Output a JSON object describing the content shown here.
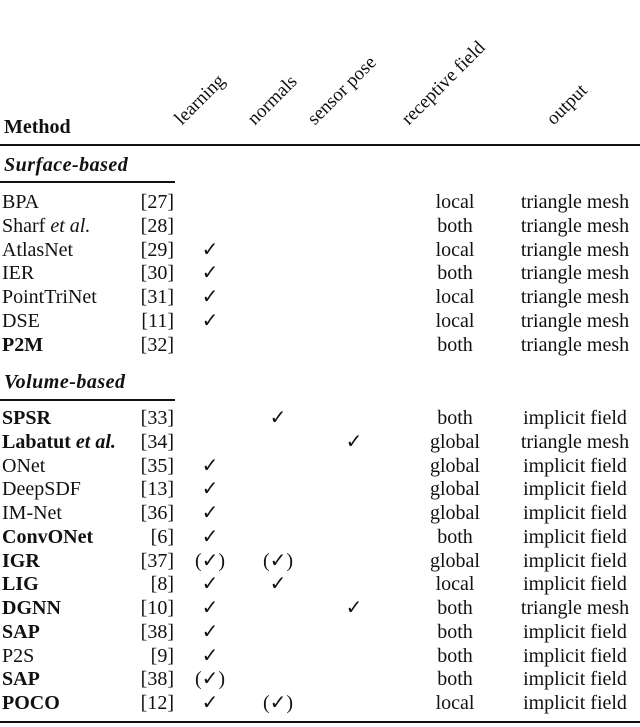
{
  "table": {
    "method_header": "Method",
    "column_headers": [
      "learning",
      "normals",
      "sensor pose",
      "receptive field",
      "output"
    ],
    "sections": [
      {
        "title": "Surface-based",
        "rows": [
          {
            "method": "BPA",
            "method_suffix": "",
            "bold": false,
            "ref": "[27]",
            "learning": "",
            "normals": "",
            "sensor_pose": "",
            "receptive_field": "local",
            "output": "triangle mesh"
          },
          {
            "method": "Sharf ",
            "method_suffix": "et al.",
            "bold": false,
            "ref": "[28]",
            "learning": "",
            "normals": "",
            "sensor_pose": "",
            "receptive_field": "both",
            "output": "triangle mesh"
          },
          {
            "method": "AtlasNet",
            "method_suffix": "",
            "bold": false,
            "ref": "[29]",
            "learning": "✓",
            "normals": "",
            "sensor_pose": "",
            "receptive_field": "local",
            "output": "triangle mesh"
          },
          {
            "method": "IER",
            "method_suffix": "",
            "bold": false,
            "ref": "[30]",
            "learning": "✓",
            "normals": "",
            "sensor_pose": "",
            "receptive_field": "both",
            "output": "triangle mesh"
          },
          {
            "method": "PointTriNet",
            "method_suffix": "",
            "bold": false,
            "ref": "[31]",
            "learning": "✓",
            "normals": "",
            "sensor_pose": "",
            "receptive_field": "local",
            "output": "triangle mesh"
          },
          {
            "method": "DSE",
            "method_suffix": "",
            "bold": false,
            "ref": "[11]",
            "learning": "✓",
            "normals": "",
            "sensor_pose": "",
            "receptive_field": "local",
            "output": "triangle mesh"
          },
          {
            "method": "P2M",
            "method_suffix": "",
            "bold": true,
            "ref": "[32]",
            "learning": "",
            "normals": "",
            "sensor_pose": "",
            "receptive_field": "both",
            "output": "triangle mesh"
          }
        ]
      },
      {
        "title": "Volume-based",
        "rows": [
          {
            "method": "SPSR",
            "method_suffix": "",
            "bold": true,
            "ref": "[33]",
            "learning": "",
            "normals": "✓",
            "sensor_pose": "",
            "receptive_field": "both",
            "output": "implicit field"
          },
          {
            "method": "Labatut ",
            "method_suffix": "et al.",
            "bold": true,
            "ref": "[34]",
            "learning": "",
            "normals": "",
            "sensor_pose": "✓",
            "receptive_field": "global",
            "output": "triangle mesh"
          },
          {
            "method": "ONet",
            "method_suffix": "",
            "bold": false,
            "ref": "[35]",
            "learning": "✓",
            "normals": "",
            "sensor_pose": "",
            "receptive_field": "global",
            "output": "implicit field"
          },
          {
            "method": "DeepSDF",
            "method_suffix": "",
            "bold": false,
            "ref": "[13]",
            "learning": "✓",
            "normals": "",
            "sensor_pose": "",
            "receptive_field": "global",
            "output": "implicit field"
          },
          {
            "method": "IM-Net",
            "method_suffix": "",
            "bold": false,
            "ref": "[36]",
            "learning": "✓",
            "normals": "",
            "sensor_pose": "",
            "receptive_field": "global",
            "output": "implicit field"
          },
          {
            "method": "ConvONet",
            "method_suffix": "",
            "bold": true,
            "ref": "[6]",
            "learning": "✓",
            "normals": "",
            "sensor_pose": "",
            "receptive_field": "both",
            "output": "implicit field"
          },
          {
            "method": "IGR",
            "method_suffix": "",
            "bold": true,
            "ref": "[37]",
            "learning": "(✓)",
            "normals": "(✓)",
            "sensor_pose": "",
            "receptive_field": "global",
            "output": "implicit field"
          },
          {
            "method": "LIG",
            "method_suffix": "",
            "bold": true,
            "ref": "[8]",
            "learning": "✓",
            "normals": "✓",
            "sensor_pose": "",
            "receptive_field": "local",
            "output": "implicit field"
          },
          {
            "method": "DGNN",
            "method_suffix": "",
            "bold": true,
            "ref": "[10]",
            "learning": "✓",
            "normals": "",
            "sensor_pose": "✓",
            "receptive_field": "both",
            "output": "triangle mesh"
          },
          {
            "method": "SAP",
            "method_suffix": "",
            "bold": true,
            "ref": "[38]",
            "learning": "✓",
            "normals": "",
            "sensor_pose": "",
            "receptive_field": "both",
            "output": "implicit field"
          },
          {
            "method": "P2S",
            "method_suffix": "",
            "bold": false,
            "ref": "[9]",
            "learning": "✓",
            "normals": "",
            "sensor_pose": "",
            "receptive_field": "both",
            "output": "implicit field"
          },
          {
            "method": "SAP",
            "method_suffix": "",
            "bold": true,
            "ref": "[38]",
            "learning": "(✓)",
            "normals": "",
            "sensor_pose": "",
            "receptive_field": "both",
            "output": "implicit field"
          },
          {
            "method": "POCO",
            "method_suffix": "",
            "bold": true,
            "ref": "[12]",
            "learning": "✓",
            "normals": "(✓)",
            "sensor_pose": "",
            "receptive_field": "local",
            "output": "implicit field"
          }
        ]
      }
    ]
  }
}
